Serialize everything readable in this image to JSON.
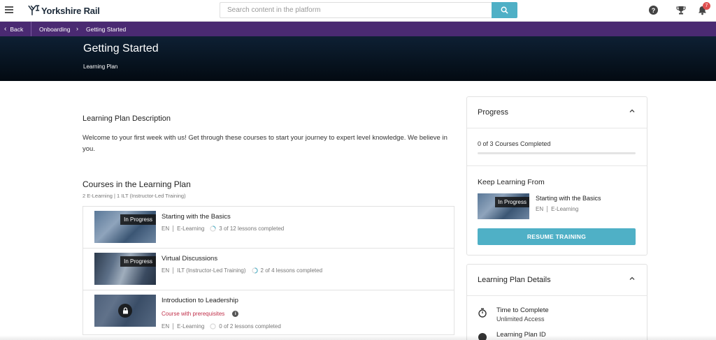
{
  "header": {
    "brand": "Yorkshire Rail",
    "search_placeholder": "Search content in the platform",
    "notification_count": "7",
    "icons": [
      "menu-icon",
      "search-icon",
      "help-icon",
      "trophy-icon",
      "bell-icon"
    ]
  },
  "breadcrumb": {
    "back_label": "Back",
    "items": [
      "Onboarding",
      "Getting Started"
    ]
  },
  "banner": {
    "title": "Getting Started",
    "subtitle": "Learning Plan"
  },
  "description": {
    "title": "Learning Plan Description",
    "text": "Welcome to your first week with us! Get through these courses to start your journey to expert level knowledge. We believe in you."
  },
  "courses": {
    "title": "Courses in the Learning Plan",
    "meta": "2 E-Learning | 1 ILT (Instructor-Led Training)",
    "items": [
      {
        "status": "In Progress",
        "title": "Starting with the Basics",
        "lang": "EN",
        "type": "E-Learning",
        "progress": "3 of 12 lessons completed",
        "progress_fraction": 0.25
      },
      {
        "status": "In Progress",
        "title": "Virtual Discussions",
        "lang": "EN",
        "type": "ILT (Instructor-Led Training)",
        "progress": "2 of 4 lessons completed",
        "progress_fraction": 0.5
      },
      {
        "status": "",
        "title": "Introduction to Leadership",
        "prereq": "Course with prerequisites",
        "lang": "EN",
        "type": "E-Learning",
        "progress": "0 of 2 lessons completed",
        "progress_fraction": 0
      }
    ]
  },
  "progress_card": {
    "title": "Progress",
    "text": "0 of 3 Courses Completed",
    "fraction": 0,
    "keep_title": "Keep Learning From",
    "keep_status": "In Progress",
    "keep_course": "Starting with the Basics",
    "keep_lang": "EN",
    "keep_type": "E-Learning",
    "resume_label": "RESUME TRAINING"
  },
  "details_card": {
    "title": "Learning Plan Details",
    "time_label": "Time to Complete",
    "time_value": "Unlimited Access",
    "id_label": "Learning Plan ID"
  },
  "colors": {
    "accent": "#4fb0c6",
    "breadcrumb_bg": "#4a2a72",
    "banner_bg": "#07131f",
    "prereq": "#c0304a",
    "badge": "#e05050"
  }
}
